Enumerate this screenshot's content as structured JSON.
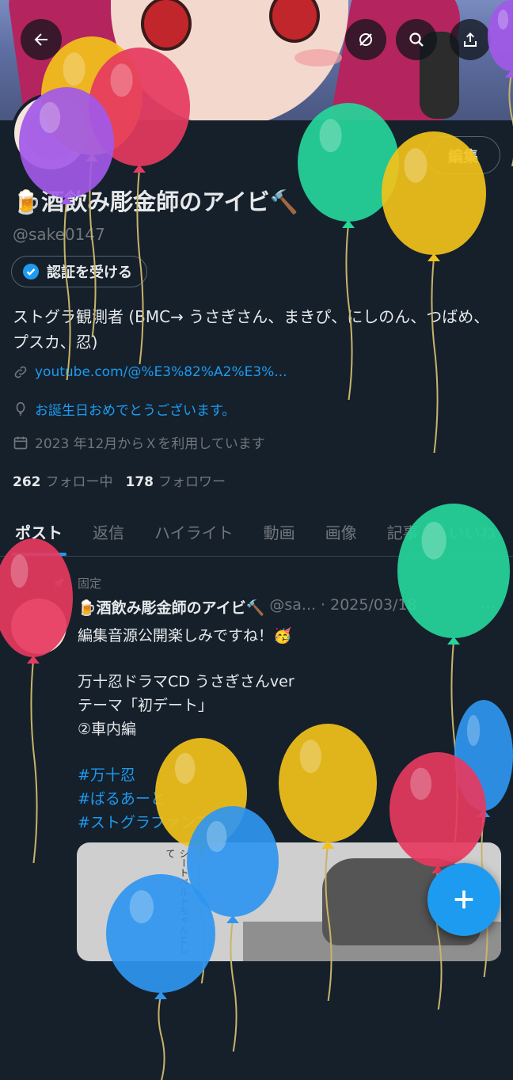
{
  "profile": {
    "display_name": "🍺酒飲み彫金師のアイビ🔨",
    "handle": "@sake0147",
    "edit_label": "編集",
    "verify_label": "認証を受ける",
    "bio": "ストグラ観測者 (BMC→ うさぎさん、まきぴ、にしのん、つばめ、プスカ、忍)",
    "link": "youtube.com/@%E3%82%A2%E3%...",
    "birthday": "お誕生日おめでとうございます。",
    "joined": "2023 年12月からＸを利用しています",
    "following_count": "262",
    "following_label": "フォロー中",
    "followers_count": "178",
    "followers_label": "フォロワー"
  },
  "tabs": [
    {
      "label": "ポスト",
      "active": true
    },
    {
      "label": "返信"
    },
    {
      "label": "ハイライト"
    },
    {
      "label": "動画"
    },
    {
      "label": "画像"
    },
    {
      "label": "記事"
    },
    {
      "label": "いいね"
    }
  ],
  "pinned_post": {
    "pinned_label": "固定",
    "author_name": "🍺酒飲み彫金師のアイビ🔨",
    "author_handle": "@sa...",
    "date": "· 2025/03/18",
    "more": "···",
    "lines": [
      "編集音源公開楽しみですね！🥳",
      "",
      "万十忍ドラマCD うさぎさんver",
      "テーマ「初デート」",
      "②車内編",
      "",
      "#万十忍",
      "#ばるあーと",
      "#ストグラファンアート"
    ],
    "media_text": "シートベルトちゃんとして"
  },
  "header_icons": [
    "back-arrow-icon",
    "grok-icon",
    "search-icon",
    "share-icon"
  ],
  "colors": {
    "background": "#15202b",
    "accent": "#1d9bf0",
    "muted": "#71767b",
    "text": "#e7e9ea"
  },
  "balloons": [
    {
      "color": "#f2c21b"
    },
    {
      "color": "#e63a5f"
    },
    {
      "color": "#a259e8"
    },
    {
      "color": "#26d69a"
    },
    {
      "color": "#f2c21b"
    },
    {
      "color": "#e63a5f"
    },
    {
      "color": "#26d69a"
    },
    {
      "color": "#2f96f0"
    },
    {
      "color": "#f2c21b"
    },
    {
      "color": "#f2c21b"
    },
    {
      "color": "#e63a5f"
    },
    {
      "color": "#2f96f0"
    },
    {
      "color": "#2f96f0"
    },
    {
      "color": "#a259e8"
    }
  ]
}
